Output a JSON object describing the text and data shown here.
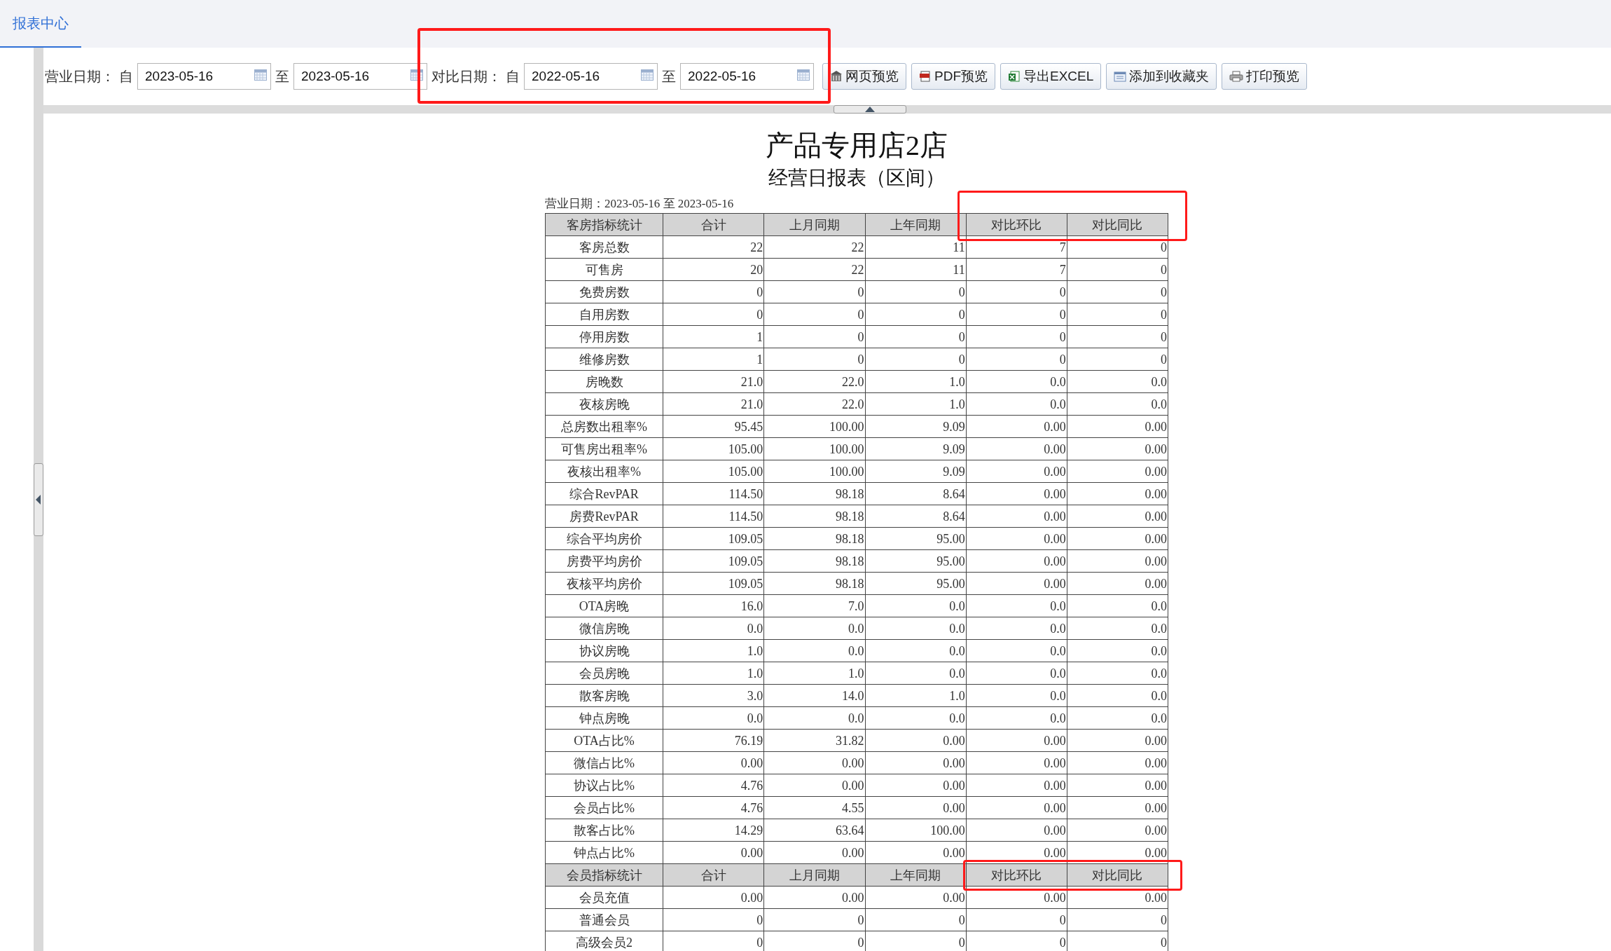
{
  "tabs": [
    {
      "label": "报表中心",
      "selected": true
    }
  ],
  "filters": [
    {
      "label": "营业日期：",
      "from_label": "自",
      "from": "2023-05-16",
      "to_label": "至",
      "to": "2023-05-16"
    },
    {
      "label": "对比日期：",
      "from_label": "自",
      "from": "2022-05-16",
      "to_label": "至",
      "to": "2022-05-16"
    }
  ],
  "buttons": [
    {
      "label": "网页预览",
      "kind": "web"
    },
    {
      "label": "PDF预览",
      "kind": "pdf"
    },
    {
      "label": "导出EXCEL",
      "kind": "excel"
    },
    {
      "label": "添加到收藏夹",
      "kind": "favorite"
    },
    {
      "label": "打印预览",
      "kind": "print"
    }
  ],
  "report": {
    "title": "产品专用店2店",
    "subtitle": "经营日报表（区间）",
    "date_line": "营业日期：2023-05-16 至 2023-05-16",
    "sections": [
      {
        "header": [
          "客房指标统计",
          "合计",
          "上月同期",
          "上年同期",
          "对比环比",
          "对比同比"
        ],
        "rows": [
          [
            "客房总数",
            "22",
            "22",
            "11",
            "7",
            "0"
          ],
          [
            "可售房",
            "20",
            "22",
            "11",
            "7",
            "0"
          ],
          [
            "免费房数",
            "0",
            "0",
            "0",
            "0",
            "0"
          ],
          [
            "自用房数",
            "0",
            "0",
            "0",
            "0",
            "0"
          ],
          [
            "停用房数",
            "1",
            "0",
            "0",
            "0",
            "0"
          ],
          [
            "维修房数",
            "1",
            "0",
            "0",
            "0",
            "0"
          ],
          [
            "房晚数",
            "21.0",
            "22.0",
            "1.0",
            "0.0",
            "0.0"
          ],
          [
            "夜核房晚",
            "21.0",
            "22.0",
            "1.0",
            "0.0",
            "0.0"
          ],
          [
            "总房数出租率%",
            "95.45",
            "100.00",
            "9.09",
            "0.00",
            "0.00"
          ],
          [
            "可售房出租率%",
            "105.00",
            "100.00",
            "9.09",
            "0.00",
            "0.00"
          ],
          [
            "夜核出租率%",
            "105.00",
            "100.00",
            "9.09",
            "0.00",
            "0.00"
          ],
          [
            "综合RevPAR",
            "114.50",
            "98.18",
            "8.64",
            "0.00",
            "0.00"
          ],
          [
            "房费RevPAR",
            "114.50",
            "98.18",
            "8.64",
            "0.00",
            "0.00"
          ],
          [
            "综合平均房价",
            "109.05",
            "98.18",
            "95.00",
            "0.00",
            "0.00"
          ],
          [
            "房费平均房价",
            "109.05",
            "98.18",
            "95.00",
            "0.00",
            "0.00"
          ],
          [
            "夜核平均房价",
            "109.05",
            "98.18",
            "95.00",
            "0.00",
            "0.00"
          ],
          [
            "OTA房晚",
            "16.0",
            "7.0",
            "0.0",
            "0.0",
            "0.0"
          ],
          [
            "微信房晚",
            "0.0",
            "0.0",
            "0.0",
            "0.0",
            "0.0"
          ],
          [
            "协议房晚",
            "1.0",
            "0.0",
            "0.0",
            "0.0",
            "0.0"
          ],
          [
            "会员房晚",
            "1.0",
            "1.0",
            "0.0",
            "0.0",
            "0.0"
          ],
          [
            "散客房晚",
            "3.0",
            "14.0",
            "1.0",
            "0.0",
            "0.0"
          ],
          [
            "钟点房晚",
            "0.0",
            "0.0",
            "0.0",
            "0.0",
            "0.0"
          ],
          [
            "OTA占比%",
            "76.19",
            "31.82",
            "0.00",
            "0.00",
            "0.00"
          ],
          [
            "微信占比%",
            "0.00",
            "0.00",
            "0.00",
            "0.00",
            "0.00"
          ],
          [
            "协议占比%",
            "4.76",
            "0.00",
            "0.00",
            "0.00",
            "0.00"
          ],
          [
            "会员占比%",
            "4.76",
            "4.55",
            "0.00",
            "0.00",
            "0.00"
          ],
          [
            "散客占比%",
            "14.29",
            "63.64",
            "100.00",
            "0.00",
            "0.00"
          ],
          [
            "钟点占比%",
            "0.00",
            "0.00",
            "0.00",
            "0.00",
            "0.00"
          ]
        ]
      },
      {
        "header": [
          "会员指标统计",
          "合计",
          "上月同期",
          "上年同期",
          "对比环比",
          "对比同比"
        ],
        "rows": [
          [
            "会员充值",
            "0.00",
            "0.00",
            "0.00",
            "0.00",
            "0.00"
          ],
          [
            "普通会员",
            "0",
            "0",
            "0",
            "0",
            "0"
          ],
          [
            "高级会员2",
            "0",
            "0",
            "0",
            "0",
            "0"
          ]
        ]
      }
    ]
  }
}
